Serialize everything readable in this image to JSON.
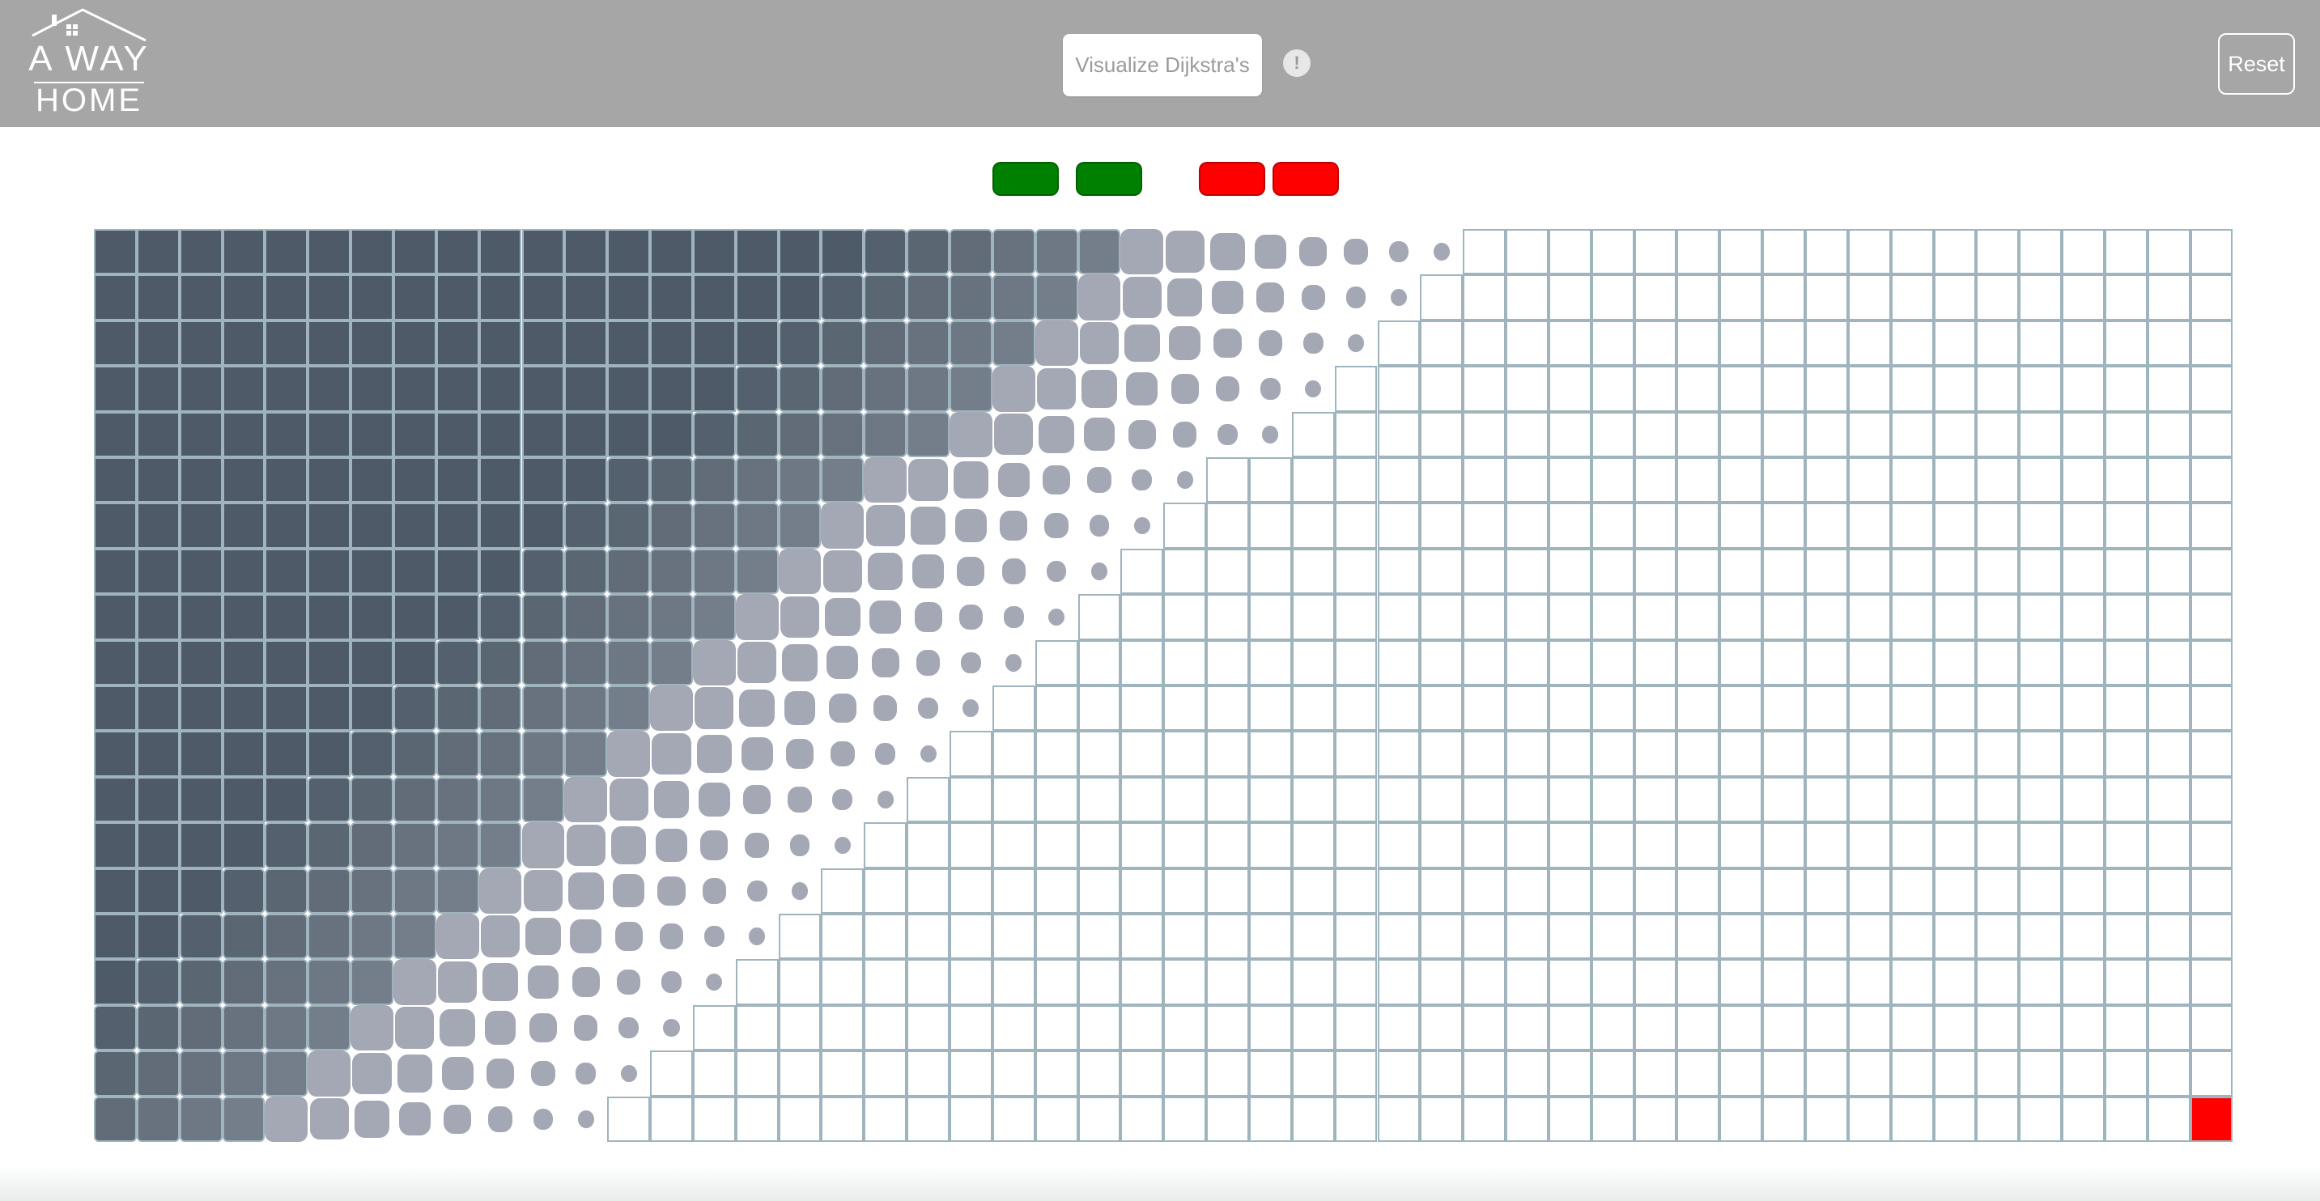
{
  "header": {
    "logo_line1": "A WAY",
    "logo_line2": "HOME",
    "visualize_label": "Visualize Dijkstra's",
    "info_label": "!",
    "reset_label": "Reset"
  },
  "legend": [
    {
      "name": "start-legend-1",
      "color": "#008000"
    },
    {
      "name": "start-legend-2",
      "color": "#008000"
    },
    {
      "name": "target-legend-1",
      "color": "#ff0000"
    },
    {
      "name": "target-legend-2",
      "color": "#ff0000"
    }
  ],
  "grid": {
    "rows": 20,
    "cols": 50,
    "frontier_by_row": [
      32,
      31,
      30,
      29,
      28,
      26,
      25,
      24,
      23,
      22,
      21,
      20,
      19,
      18,
      17,
      16,
      15,
      14,
      13,
      12
    ],
    "target": {
      "row": 19,
      "col": 49
    },
    "colors": {
      "visited": "#4e5a67",
      "wave": "#a3a8b4",
      "unvisited": "#ffffff",
      "border": "#9fb4bd",
      "target": "#ff0000"
    }
  }
}
